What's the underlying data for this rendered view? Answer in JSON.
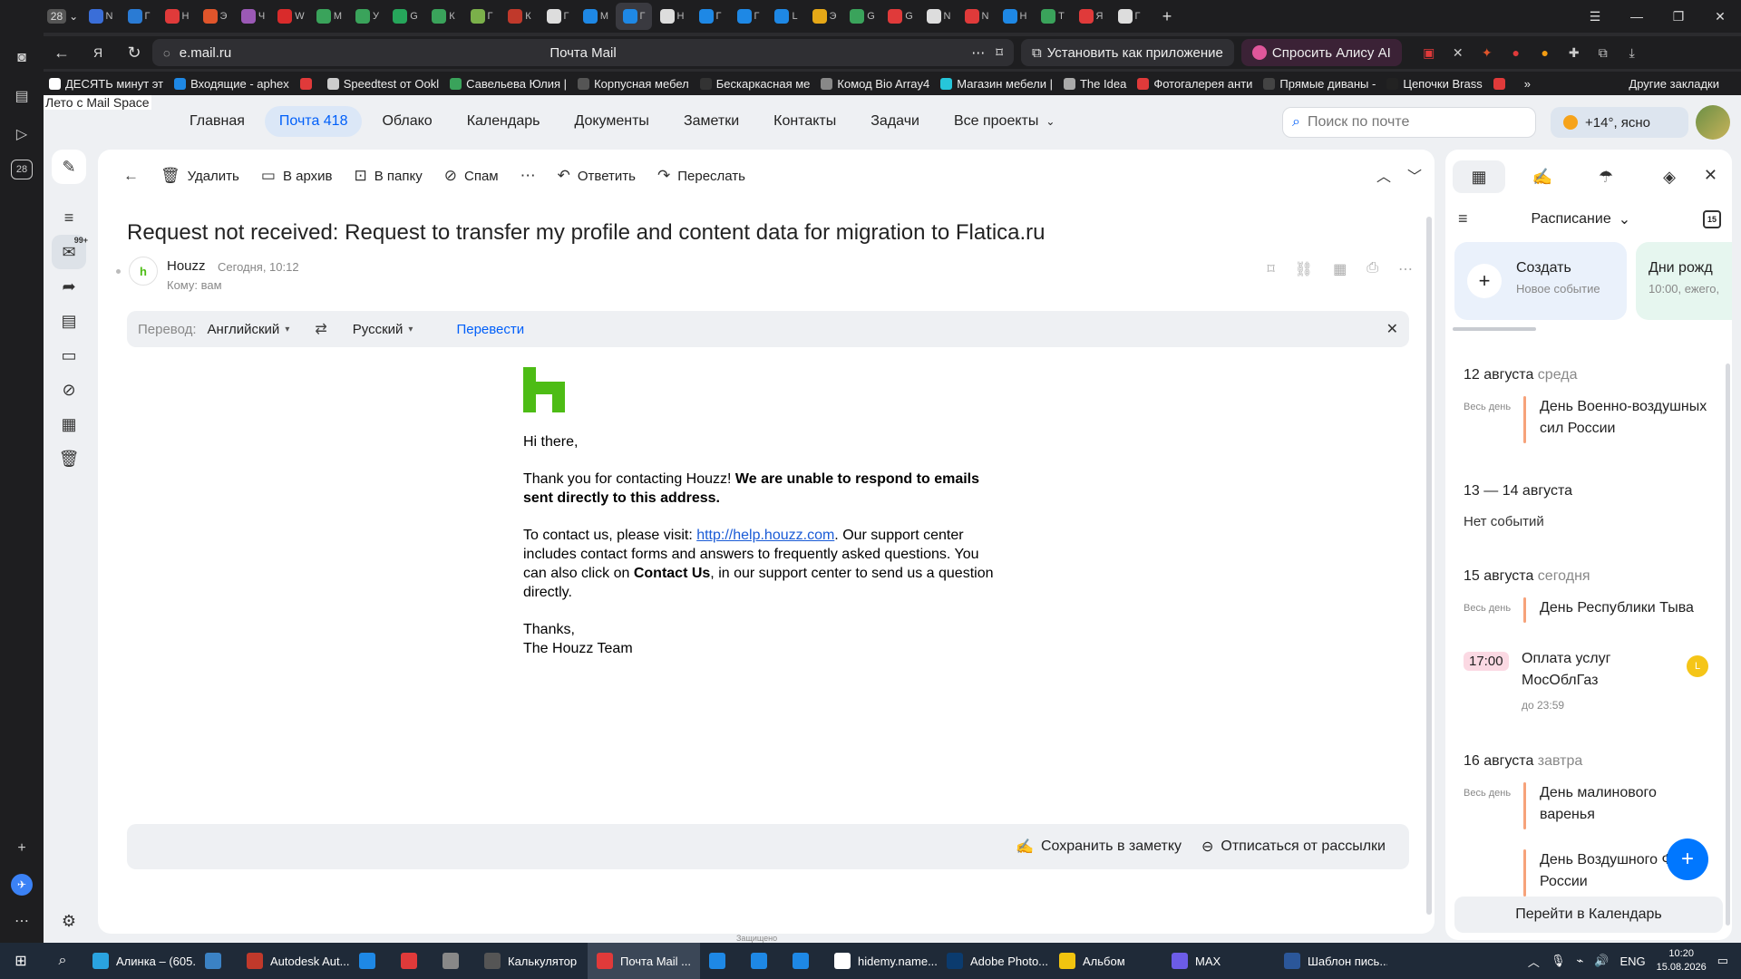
{
  "browser": {
    "tab_count": "28",
    "url": "e.mail.ru",
    "page_title": "Почта Mail",
    "install_label": "Установить как приложение",
    "alice_label": "Спросить Алису AI",
    "tabs": [
      {
        "letter": "N",
        "color": "#3a6ed8"
      },
      {
        "letter": "Г",
        "color": "#2a7bd4"
      },
      {
        "letter": "Н",
        "color": "#e03a3a"
      },
      {
        "letter": "Э",
        "color": "#e0552b"
      },
      {
        "letter": "Ч",
        "color": "#9b59b6"
      },
      {
        "letter": "W",
        "color": "#d92b2b"
      },
      {
        "letter": "М",
        "color": "#3aa35b"
      },
      {
        "letter": "У",
        "color": "#3aa35b"
      },
      {
        "letter": "G",
        "color": "#26a65b"
      },
      {
        "letter": "К",
        "color": "#3aa35b"
      },
      {
        "letter": "Г",
        "color": "#7bb04a"
      },
      {
        "letter": "К",
        "color": "#c0392b"
      },
      {
        "letter": "Г",
        "color": "#dddddd"
      },
      {
        "letter": "М",
        "color": "#1e88e5"
      },
      {
        "letter": "Г",
        "color": "#1e88e5"
      },
      {
        "letter": "Н",
        "color": "#dddddd"
      },
      {
        "letter": "Г",
        "color": "#1e88e5"
      },
      {
        "letter": "Г",
        "color": "#1e88e5"
      },
      {
        "letter": "L",
        "color": "#1e88e5"
      },
      {
        "letter": "Э",
        "color": "#e6a817"
      },
      {
        "letter": "G",
        "color": "#3aa35b"
      },
      {
        "letter": "G",
        "color": "#e03a3a"
      },
      {
        "letter": "N",
        "color": "#dddddd"
      },
      {
        "letter": "N",
        "color": "#e03a3a"
      },
      {
        "letter": "Н",
        "color": "#1e88e5"
      },
      {
        "letter": "Т",
        "color": "#3aa35b"
      },
      {
        "letter": "Я",
        "color": "#e03a3a"
      },
      {
        "letter": "Г",
        "color": "#dddddd"
      }
    ]
  },
  "bookmarks": [
    {
      "label": "ДЕСЯТЬ минут эт",
      "color": "#ffffff"
    },
    {
      "label": "Входящие - aphex",
      "color": "#1e88e5"
    },
    {
      "label": "",
      "color": "#e03a3a"
    },
    {
      "label": "Speedtest от Ookl",
      "color": "#cccccc"
    },
    {
      "label": "Савельева Юлия |",
      "color": "#3aa35b"
    },
    {
      "label": "Корпусная мебел",
      "color": "#555555"
    },
    {
      "label": "Бескаркасная ме",
      "color": "#333333"
    },
    {
      "label": "Комод Bio Array4",
      "color": "#888888"
    },
    {
      "label": "Магазин мебели |",
      "color": "#26c6da"
    },
    {
      "label": "The Idea",
      "color": "#aaaaaa"
    },
    {
      "label": "Фотогалерея анти",
      "color": "#e03a3a"
    },
    {
      "label": "Прямые диваны -",
      "color": "#444444"
    },
    {
      "label": "Цепочки Brass",
      "color": "#222222"
    },
    {
      "label": "",
      "color": "#e03a3a"
    }
  ],
  "bookmarks_other": "Другие закладки",
  "mail": {
    "banner_alt": "Лето с Mail Space",
    "nav": [
      {
        "label": "Главная",
        "active": false
      },
      {
        "label": "Почта 418",
        "active": true
      },
      {
        "label": "Облако",
        "active": false
      },
      {
        "label": "Календарь",
        "active": false
      },
      {
        "label": "Документы",
        "active": false
      },
      {
        "label": "Заметки",
        "active": false
      },
      {
        "label": "Контакты",
        "active": false
      },
      {
        "label": "Задачи",
        "active": false
      },
      {
        "label": "Все проекты",
        "active": false
      }
    ],
    "search_placeholder": "Поиск по почте",
    "weather": "+14°, ясно",
    "inbox_badge": "99+",
    "toolbar": {
      "delete": "Удалить",
      "archive": "В архив",
      "folder": "В папку",
      "spam": "Спам",
      "reply": "Ответить",
      "forward": "Переслать"
    },
    "letter": {
      "subject": "Request not received: Request to transfer my profile and content data for migration to Flatica.ru",
      "sender": "Houzz",
      "time": "Сегодня, 10:12",
      "to": "Кому: вам",
      "translate": {
        "label": "Перевод:",
        "from": "Английский",
        "to": "Русский",
        "action": "Перевести"
      },
      "greeting": "Hi there,",
      "p1_start": "Thank you for contacting Houzz! ",
      "p1_bold": "We are unable to respond to emails sent directly to this address.",
      "p2_start": "To contact us, please visit: ",
      "p2_link": "http://help.houzz.com",
      "p2_mid": ". Our support center includes contact forms and answers to frequently asked questions. You can also click on ",
      "p2_bold": "Contact Us",
      "p2_end": ", in our support center to send us a question directly.",
      "thanks": "Thanks,",
      "team": "The Houzz Team",
      "save_note": "Сохранить в заметку",
      "unsubscribe": "Отписаться от рассылки",
      "secured": "Защищено"
    }
  },
  "calendar": {
    "title": "Расписание",
    "day_icon": "15",
    "create_title": "Создать",
    "create_sub": "Новое событие",
    "bday_title": "Дни рожд",
    "bday_sub": "10:00, ежего,",
    "all_day": "Весь день",
    "days": [
      {
        "date": "12 августа",
        "rel": "среда"
      },
      {
        "date": "13 — 14 августа",
        "rel": ""
      },
      {
        "date": "15 августа",
        "rel": "сегодня"
      },
      {
        "date": "16 августа",
        "rel": "завтра"
      }
    ],
    "no_events": "Нет событий",
    "events": {
      "e1": "День Военно-воздушных сил России",
      "e2": "День Республики Тыва",
      "e3_time": "17:00",
      "e3": "Оплата услуг МосОблГаз",
      "e3_sub": "до 23:59",
      "e3_who": "L",
      "e4": "День малинового варенья",
      "e5": "День Воздушного Флота России"
    },
    "go_label": "Перейти в Календарь"
  },
  "taskbar": {
    "apps": [
      {
        "label": "Алинка – (605...",
        "color": "#2aa3e0",
        "active": false
      },
      {
        "label": "",
        "color": "#3b82c4",
        "active": false
      },
      {
        "label": "Autodesk Aut...",
        "color": "#c0392b",
        "active": false
      },
      {
        "label": "",
        "color": "#1e88e5",
        "active": false
      },
      {
        "label": "",
        "color": "#e03a3a",
        "active": false
      },
      {
        "label": "",
        "color": "#888888",
        "active": false
      },
      {
        "label": "Калькулятор",
        "color": "#555555",
        "active": false
      },
      {
        "label": "Почта Mail ...",
        "color": "#e03a3a",
        "active": true
      },
      {
        "label": "",
        "color": "#1e88e5",
        "active": false
      },
      {
        "label": "",
        "color": "#1e88e5",
        "active": false
      },
      {
        "label": "",
        "color": "#1e88e5",
        "active": false
      },
      {
        "label": "hidemy.name...",
        "color": "#ffffff",
        "active": false
      },
      {
        "label": "Adobe Photo...",
        "color": "#0b3b6e",
        "active": false
      },
      {
        "label": "Альбом",
        "color": "#f1c40f",
        "active": false
      },
      {
        "label": "MAX",
        "color": "#6c5ce7",
        "active": false
      },
      {
        "label": "Шаблон пись...",
        "color": "#2b579a",
        "active": false
      }
    ],
    "lang": "ENG",
    "time": "10:20",
    "date": "15.08.2026"
  }
}
